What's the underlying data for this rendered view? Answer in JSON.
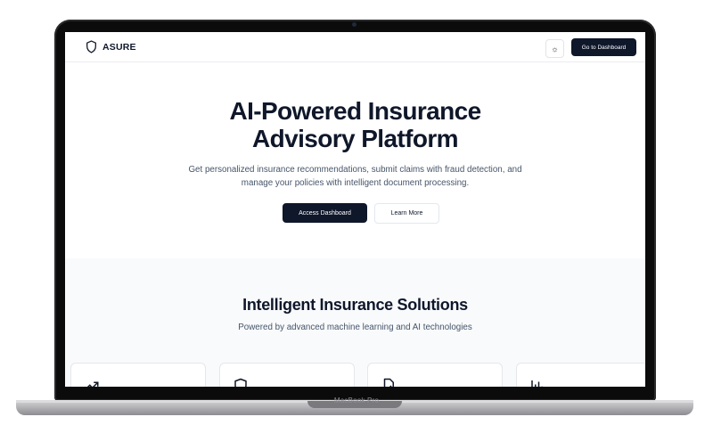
{
  "device": {
    "label": "MacBook Pro"
  },
  "nav": {
    "brand": "ASURE",
    "theme_toggle_icon": "sun-icon",
    "dashboard_button": "Go to Dashboard"
  },
  "hero": {
    "title_line1": "AI-Powered Insurance",
    "title_line2": "Advisory Platform",
    "subtitle": "Get personalized insurance recommendations, submit claims with fraud detection, and manage your policies with intelligent document processing.",
    "primary_button": "Access Dashboard",
    "secondary_button": "Learn More"
  },
  "features": {
    "title": "Intelligent Insurance Solutions",
    "subtitle": "Powered by advanced machine learning and AI technologies",
    "cards": [
      {
        "icon": "trending-up-icon"
      },
      {
        "icon": "shield-icon"
      },
      {
        "icon": "file-check-icon"
      },
      {
        "icon": "bar-chart-icon"
      }
    ]
  },
  "colors": {
    "primary": "#0f172a",
    "muted_text": "#475569",
    "section_bg": "#f8fafc"
  }
}
